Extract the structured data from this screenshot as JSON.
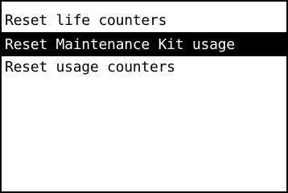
{
  "menu": {
    "items": [
      {
        "label": "Reset life counters",
        "selected": false
      },
      {
        "label": "Reset Maintenance Kit usage",
        "selected": true
      },
      {
        "label": "Reset usage counters",
        "selected": false
      }
    ]
  },
  "colors": {
    "background": "#ffffff",
    "text": "#000000",
    "highlight": "#000000",
    "highlight_text": "#ffffff"
  }
}
